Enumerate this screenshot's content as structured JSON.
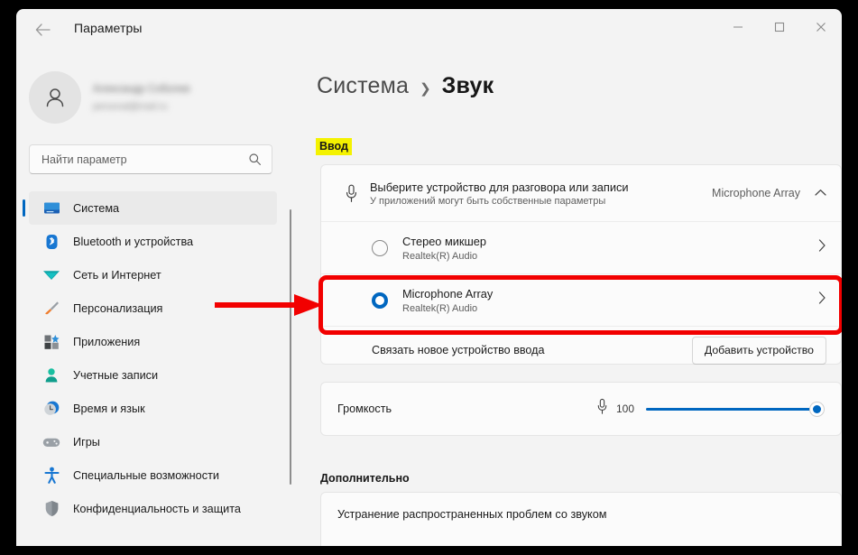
{
  "window": {
    "title": "Параметры",
    "back_icon": "back-arrow-icon",
    "minimize_label": "—",
    "maximize_label": "□",
    "close_label": "✕"
  },
  "sidebar": {
    "profile": {
      "avatar_icon": "person-avatar-icon",
      "name": "Александр Соболев",
      "email": "personal@mail.ru"
    },
    "search": {
      "placeholder": "Найти параметр",
      "value": "",
      "icon": "search-icon"
    },
    "items": [
      {
        "label": "Система",
        "icon": "monitor-icon",
        "selected": true
      },
      {
        "label": "Bluetooth и устройства",
        "icon": "bluetooth-icon",
        "selected": false
      },
      {
        "label": "Сеть и Интернет",
        "icon": "wifi-icon",
        "selected": false
      },
      {
        "label": "Персонализация",
        "icon": "paintbrush-icon",
        "selected": false
      },
      {
        "label": "Приложения",
        "icon": "apps-icon",
        "selected": false
      },
      {
        "label": "Учетные записи",
        "icon": "account-icon",
        "selected": false
      },
      {
        "label": "Время и язык",
        "icon": "clock-icon",
        "selected": false
      },
      {
        "label": "Игры",
        "icon": "gamepad-icon",
        "selected": false
      },
      {
        "label": "Специальные возможности",
        "icon": "accessibility-icon",
        "selected": false
      },
      {
        "label": "Конфиденциальность и защита",
        "icon": "shield-icon",
        "selected": false
      }
    ]
  },
  "content": {
    "breadcrumb": {
      "parent": "Система",
      "separator": "❯",
      "current": "Звук"
    },
    "input_section": {
      "label": "Ввод",
      "highlight_color": "#f4f200",
      "picker": {
        "icon": "microphone-icon",
        "title": "Выберите устройство для разговора или записи",
        "subtitle": "У приложений могут быть собственные параметры",
        "value": "Microphone Array",
        "chevron": "chevron-up-icon"
      },
      "devices": [
        {
          "name": "Стерео микшер",
          "driver": "Realtek(R) Audio",
          "selected": false,
          "chevron": "chevron-right-icon"
        },
        {
          "name": "Microphone Array",
          "driver": "Realtek(R) Audio",
          "selected": true,
          "chevron": "chevron-right-icon"
        }
      ],
      "pair": {
        "label": "Связать новое устройство ввода",
        "button": "Добавить устройство"
      },
      "volume": {
        "label": "Громкость",
        "icon": "microphone-icon",
        "value": "100",
        "percent": 100
      }
    },
    "advanced_section": {
      "label": "Дополнительно",
      "items": [
        {
          "label": "Устранение распространенных проблем со звуком"
        }
      ]
    }
  },
  "annotations": {
    "arrow": {
      "name": "red-pointer-arrow",
      "color": "#f20000"
    },
    "highlight_box": {
      "name": "red-highlight-box",
      "color": "#f20000"
    }
  }
}
